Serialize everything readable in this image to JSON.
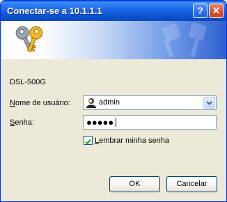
{
  "window": {
    "title": "Conectar-se a 10.1.1.1",
    "help_glyph": "?",
    "close_glyph": "✕"
  },
  "banner": {
    "icon": "keys-icon"
  },
  "form": {
    "server_name": "DSL-500G",
    "username_label_first": "N",
    "username_label_rest": "ome de usuário:",
    "username_value": "admin",
    "username_icon": "user-icon",
    "password_label_first": "S",
    "password_label_rest": "enha:",
    "password_masked": "●●●●●",
    "remember_checked": true,
    "remember_label_first": "L",
    "remember_label_rest": "embrar minha senha"
  },
  "buttons": {
    "ok_label": "OK",
    "cancel_label": "Cancelar"
  },
  "colors": {
    "titlebar": "#0a54d4",
    "close_button": "#d8532f",
    "dialog_background": "#ece9d8",
    "input_border": "#7f9db9",
    "check_mark": "#21a121"
  }
}
